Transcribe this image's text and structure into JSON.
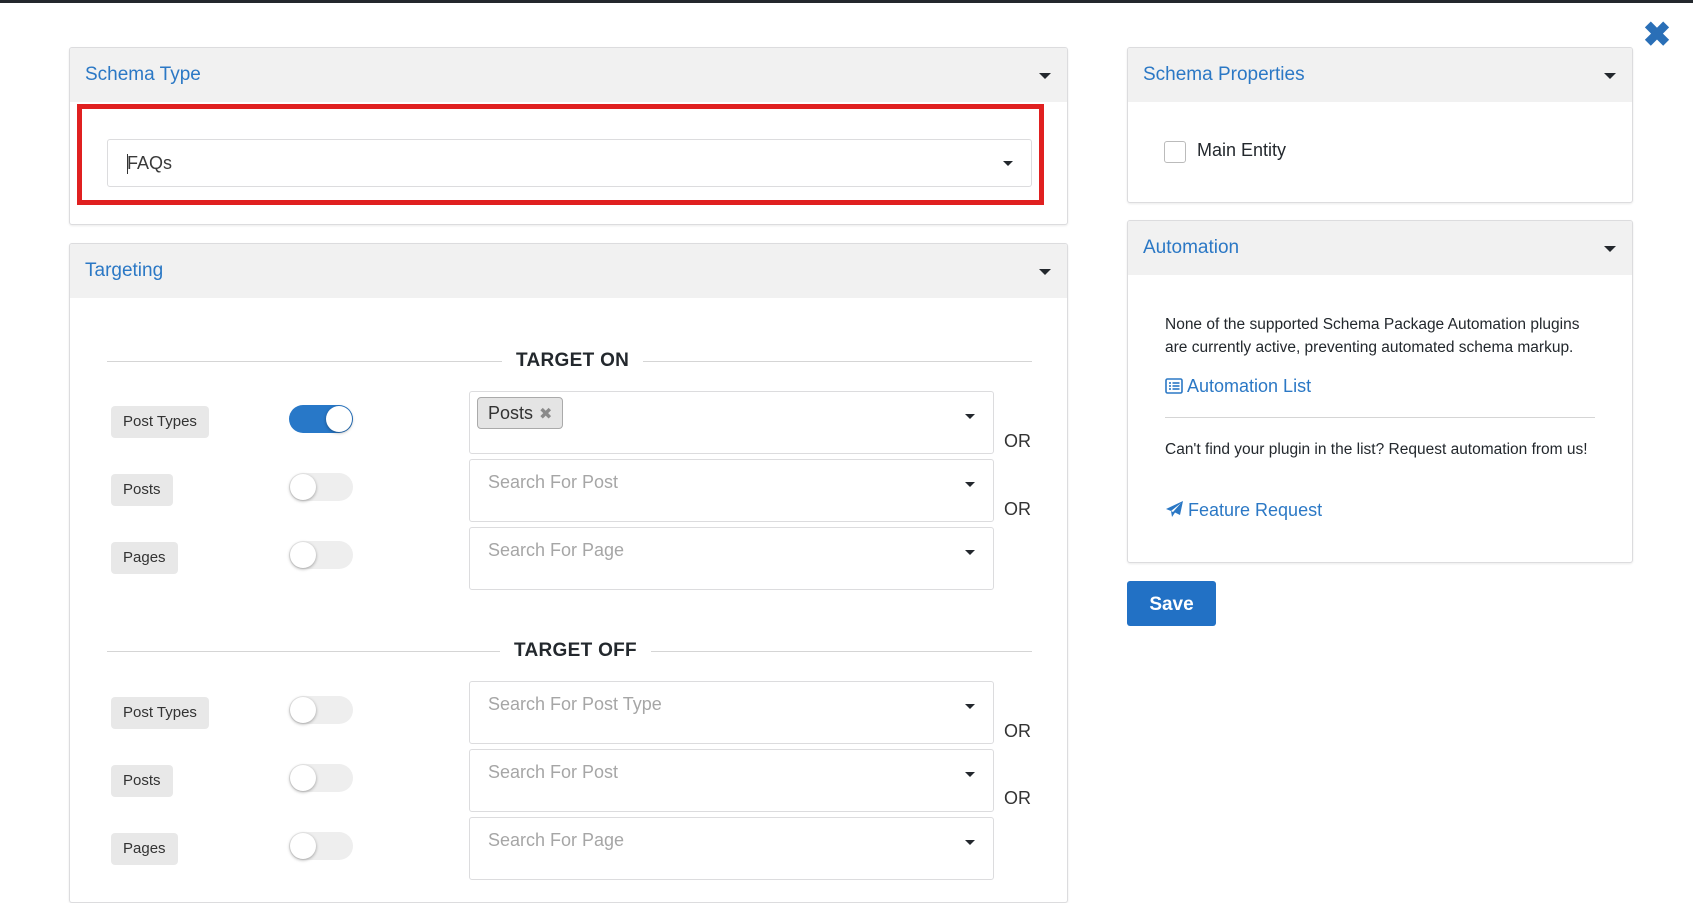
{
  "schema_type": {
    "title": "Schema Type",
    "selected": "FAQs"
  },
  "targeting": {
    "title": "Targeting",
    "target_on": {
      "label": "TARGET ON",
      "rows": [
        {
          "label": "Post Types",
          "enabled": true,
          "tag": "Posts",
          "placeholder": "",
          "or": "OR"
        },
        {
          "label": "Posts",
          "enabled": false,
          "placeholder": "Search For Post",
          "or": "OR"
        },
        {
          "label": "Pages",
          "enabled": false,
          "placeholder": "Search For Page"
        }
      ]
    },
    "target_off": {
      "label": "TARGET OFF",
      "rows": [
        {
          "label": "Post Types",
          "enabled": false,
          "placeholder": "Search For Post Type",
          "or": "OR"
        },
        {
          "label": "Posts",
          "enabled": false,
          "placeholder": "Search For Post",
          "or": "OR"
        },
        {
          "label": "Pages",
          "enabled": false,
          "placeholder": "Search For Page"
        }
      ]
    }
  },
  "schema_properties": {
    "title": "Schema Properties",
    "main_entity_label": "Main Entity",
    "main_entity_checked": false
  },
  "automation": {
    "title": "Automation",
    "message": "None of the supported Schema Package Automation plugins are currently active, preventing automated schema markup.",
    "list_link": "Automation List",
    "request_text": "Can't find your plugin in the list? Request automation from us!",
    "request_link": "Feature Request"
  },
  "save_label": "Save",
  "colors": {
    "accent": "#2b78c5",
    "highlight": "#e02020",
    "toggle_on": "#2878c8"
  }
}
